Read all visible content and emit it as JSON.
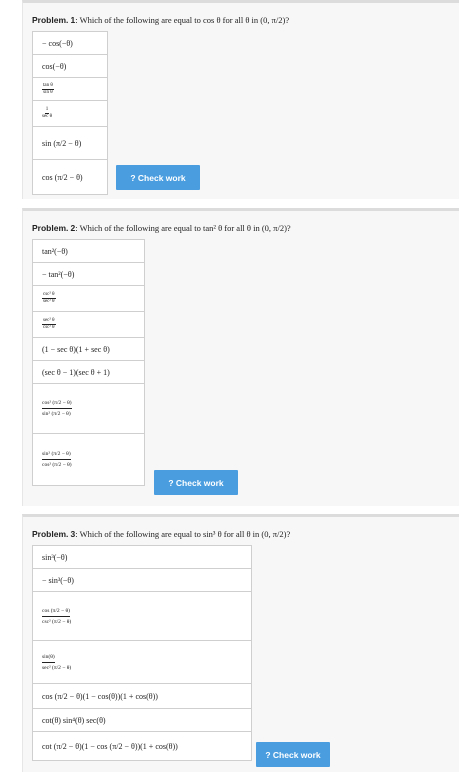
{
  "problems": [
    {
      "label": "Problem.",
      "number": "1",
      "question": ": Which of the following are equal to cos θ for all θ in (0, π/2)?",
      "choices": [
        "− cos(−θ)",
        "cos(−θ)",
        {
          "num": "tan θ",
          "den": "sin θ"
        },
        {
          "num": "1",
          "den": "sec θ"
        },
        "sin (π/2 − θ)",
        "cos (π/2 − θ)"
      ],
      "button": "? Check work"
    },
    {
      "label": "Problem.",
      "number": "2",
      "question": ": Which of the following are equal to tan² θ for all θ in (0, π/2)?",
      "choices": [
        "tan²(−θ)",
        "− tan²(−θ)",
        {
          "num": "csc² θ",
          "den": "sec² θ"
        },
        {
          "num": "sec² θ",
          "den": "csc² θ"
        },
        "(1 − sec θ)(1 + sec θ)",
        "(sec θ − 1)(sec θ + 1)",
        {
          "num": "cos² (π/2 − θ)",
          "den": "sin² (π/2 − θ)"
        },
        {
          "num": "sin² (π/2 − θ)",
          "den": "cos² (π/2 − θ)"
        }
      ],
      "button": "? Check work"
    },
    {
      "label": "Problem.",
      "number": "3",
      "question": ": Which of the following are equal to sin³ θ for all θ in (0, π/2)?",
      "choices": [
        "sin³(−θ)",
        "− sin³(−θ)",
        {
          "num": "cos (π/2 − θ)",
          "den": "csc² (π/2 − θ)"
        },
        {
          "num": "sin(θ)",
          "den": "sec² (π/2 − θ)"
        },
        "cos (π/2 − θ)(1 − cos(θ))(1 + cos(θ))",
        "cot(θ) sin⁴(θ) sec(θ)",
        "cot (π/2 − θ)(1 − cos (π/2 − θ))(1 + cos(θ))"
      ],
      "button": "? Check work"
    }
  ]
}
